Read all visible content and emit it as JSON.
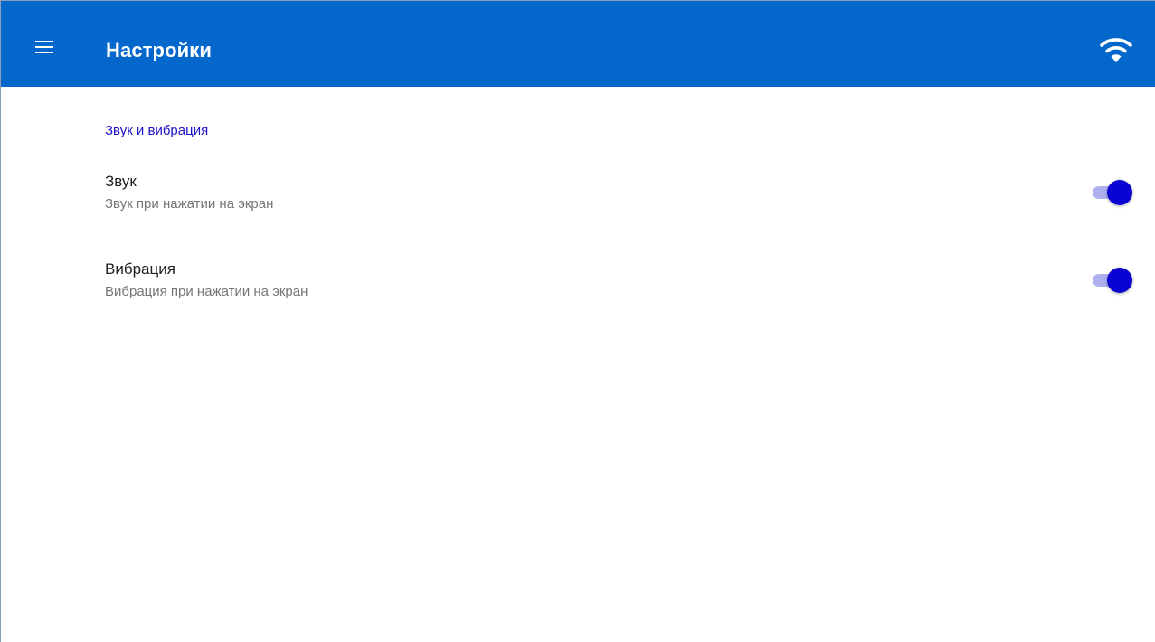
{
  "app_bar": {
    "title": "Настройки",
    "menu_icon": "hamburger-menu-icon",
    "status_icon": "wifi-icon",
    "background_color": "#0367cc"
  },
  "section": {
    "title": "Звук и вибрация",
    "color": "#1a10c9"
  },
  "preferences": [
    {
      "title": "Звук",
      "summary": "Звук при нажатии на экран",
      "enabled": true
    },
    {
      "title": "Вибрация",
      "summary": "Вибрация при нажатии на экран",
      "enabled": true
    }
  ],
  "switch_colors": {
    "thumb": "#0a04d2",
    "track": "#aeb0ef"
  }
}
